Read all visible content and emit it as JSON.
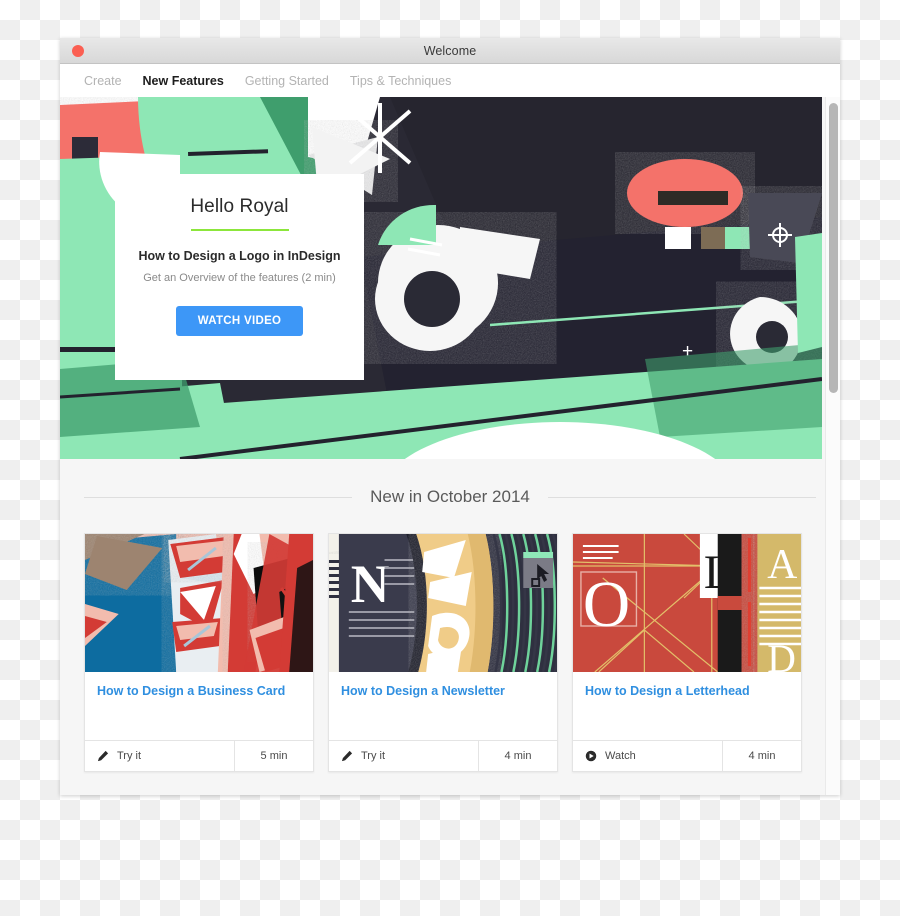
{
  "window": {
    "title": "Welcome",
    "close_button": "close"
  },
  "tabs": [
    {
      "label": "Create",
      "active": false
    },
    {
      "label": "New Features",
      "active": true
    },
    {
      "label": "Getting Started",
      "active": false
    },
    {
      "label": "Tips & Techniques",
      "active": false
    }
  ],
  "hero": {
    "greeting": "Hello Royal",
    "headline": "How to Design a Logo in InDesign",
    "description": "Get an Overview of the features (2 min)",
    "cta_label": "WATCH VIDEO",
    "cta_color": "#3d97f7",
    "rule_color": "#8ce63b",
    "art_colors": {
      "background": "#2a2934",
      "mint": "#8ee7b5",
      "mint_dark": "#3f9e6d",
      "coral": "#f4726a",
      "white": "#ffffff",
      "taupe": "#7d6c55"
    }
  },
  "section": {
    "title": "New in October 2014"
  },
  "cards": [
    {
      "title": "How to Design a Business Card",
      "action_label": "Try it",
      "action_icon": "pencil-icon",
      "duration": "5 min",
      "thumb_colors": {
        "a": "#0d6ca0",
        "b": "#d33b35",
        "c": "#f2bcae",
        "d": "#111111",
        "e": "#9d8470"
      }
    },
    {
      "title": "How to Design a Newsletter",
      "action_label": "Try it",
      "action_icon": "pencil-icon",
      "duration": "4 min",
      "thumb_colors": {
        "a": "#2f3040",
        "b": "#f0cc88",
        "c": "#ffffff",
        "d": "#6fd39b",
        "e": "#7b7b86"
      }
    },
    {
      "title": "How to Design a Letterhead",
      "action_label": "Watch",
      "action_icon": "play-circle-icon",
      "duration": "4 min",
      "thumb_colors": {
        "a": "#c94a3d",
        "b": "#d4b96a",
        "c": "#ffffff",
        "d": "#1a1a1a",
        "e": "#e0c87a"
      }
    }
  ],
  "scrollbar": {
    "thumb_color": "#b6b6b6"
  }
}
